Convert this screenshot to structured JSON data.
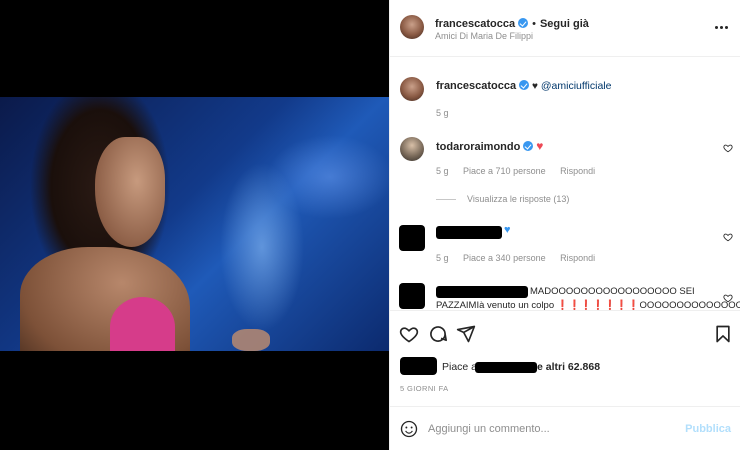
{
  "header": {
    "username": "francescatocca",
    "separator": "•",
    "follow_label": "Segui già",
    "subtitle": "Amici Di Maria De Filippi"
  },
  "caption": {
    "username": "francescatocca",
    "heart": "♥",
    "mention": "@amiciufficiale",
    "age": "5 g"
  },
  "comments": [
    {
      "username": "todaroraimondo",
      "emoji": "♥",
      "age": "5 g",
      "likes": "Piace a 710 persone",
      "reply_label": "Rispondi",
      "view_replies": "Visualizza le risposte (13)"
    },
    {
      "emoji": "♥",
      "age": "5 g",
      "likes": "Piace a 340 persone",
      "reply_label": "Rispondi"
    },
    {
      "text_line1": "MADOOOOOOOOOOOOOOOOO SEI",
      "text_line2": "PAZZAIMIà venuto un colpo ❗❗❗❗❗❗❗OOOOOOOOOOOOOOOOOOOO"
    }
  ],
  "likes_summary": {
    "prefix": "Piace a",
    "suffix": "e altri 62.868"
  },
  "timestamp": "5 GIORNI FA",
  "composer": {
    "placeholder": "Aggiungi un commento...",
    "publish_label": "Pubblica"
  },
  "icons": [
    "more-icon",
    "heart-icon",
    "comment-icon",
    "share-icon",
    "bookmark-icon",
    "emoji-icon",
    "verified-icon"
  ],
  "colors": {
    "verified": "#3897f0",
    "red_heart": "#ed4956",
    "blue_heart": "#3897f0",
    "publish_disabled": "#b2dffc"
  }
}
